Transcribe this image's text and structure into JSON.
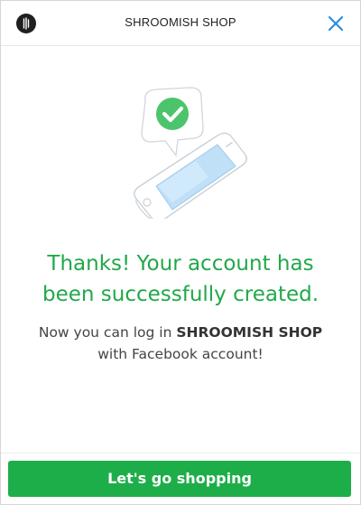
{
  "header": {
    "title": "SHROOMISH SHOP",
    "close_icon": "close-icon",
    "logo_icon": "shop-logo-icon"
  },
  "confirmation": {
    "illustration_icon": "phone-with-checkmark-icon",
    "headline_line1": "Thanks! Your account has",
    "headline_line2": "been successfully created.",
    "sub_line1_prefix": "Now you can log in ",
    "sub_line1_shop": "SHROOMISH SHOP",
    "sub_line2": "with Facebook account!"
  },
  "footer": {
    "cta_label": "Let's go shopping"
  },
  "colors": {
    "accent_green": "#1eae49",
    "headline_green": "#21a84a",
    "close_blue": "#2a8fe0"
  }
}
